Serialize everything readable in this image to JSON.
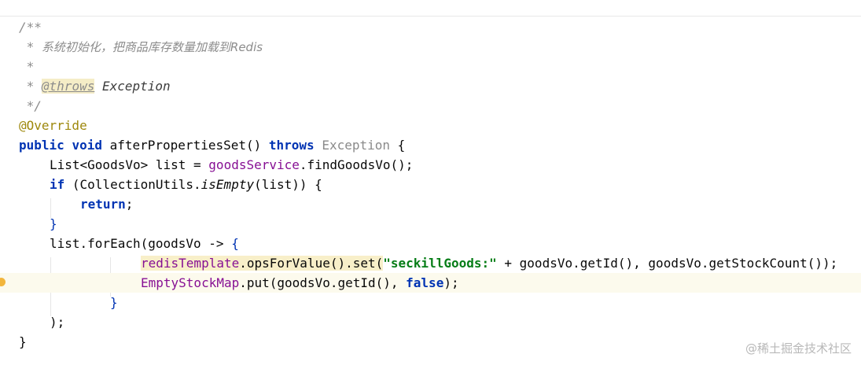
{
  "watermark": "@稀土掘金技术社区",
  "code": {
    "l1": "/**",
    "l2_star": " * ",
    "l2_text": "系统初始化，把商品库存数量加载到Redis",
    "l3": " *",
    "l4_star": " * ",
    "l4_tag": "@throws",
    "l4_ref": " Exception",
    "l5": " */",
    "l6": "@Override",
    "l7_kw1": "public",
    "l7_kw2": "void",
    "l7_name": " afterPropertiesSet() ",
    "l7_kw3": "throws",
    "l7_exc": "Exception",
    "l7_brace": " {",
    "l8_a": "List<GoodsVo> list = ",
    "l8_field": "goodsService",
    "l8_b": ".findGoodsVo();",
    "l9_kw": "if",
    "l9_a": " (CollectionUtils.",
    "l9_static": "isEmpty",
    "l9_b": "(list)) {",
    "l10_kw": "return",
    "l10_semi": ";",
    "l11": "}",
    "l12_a": "list.forEach(goodsVo -> ",
    "l12_brace": "{",
    "l13_field": "redisTemplate",
    "l13_a": ".opsForValue().set(",
    "l13_str": "\"seckillGoods:\"",
    "l13_b": " + goodsVo.getId(), goodsVo.getStockCount());",
    "l14_field": "EmptyStockMap",
    "l14_a": ".put(goodsVo.getId(), ",
    "l14_kw": "false",
    "l14_b": ");",
    "l15": "}",
    "l16": ");",
    "l17": "}"
  }
}
